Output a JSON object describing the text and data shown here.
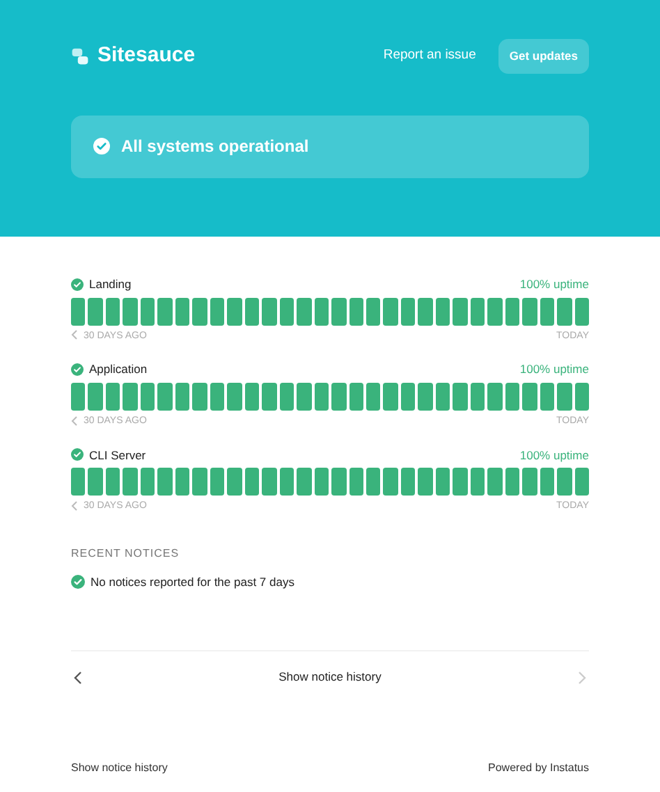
{
  "header": {
    "brand": "Sitesauce",
    "report_link": "Report an issue",
    "updates_button": "Get updates",
    "status": "All systems operational"
  },
  "services": [
    {
      "name": "Landing",
      "uptime": "100% uptime",
      "days": [
        {
          "color": "#3ab37c"
        },
        {
          "color": "#3ab37c"
        },
        {
          "color": "#3ab37c"
        },
        {
          "color": "#3ab37c"
        },
        {
          "color": "#3ab37c"
        },
        {
          "color": "#3ab37c"
        },
        {
          "color": "#3ab37c"
        },
        {
          "color": "#3ab37c"
        },
        {
          "color": "#3ab37c"
        },
        {
          "color": "#3ab37c"
        },
        {
          "color": "#3ab37c"
        },
        {
          "color": "#3ab37c"
        },
        {
          "color": "#3ab37c"
        },
        {
          "color": "#3ab37c"
        },
        {
          "color": "#3ab37c"
        },
        {
          "color": "#3ab37c"
        },
        {
          "color": "#3ab37c"
        },
        {
          "color": "#3ab37c"
        },
        {
          "color": "#3ab37c"
        },
        {
          "color": "#3ab37c"
        },
        {
          "color": "#3ab37c"
        },
        {
          "color": "#3ab37c"
        },
        {
          "color": "#3ab37c"
        },
        {
          "color": "#3ab37c"
        },
        {
          "color": "#3ab37c"
        },
        {
          "color": "#3ab37c"
        },
        {
          "color": "#3ab37c"
        },
        {
          "color": "#3ab37c"
        },
        {
          "color": "#3ab37c"
        },
        {
          "color": "#3ab37c"
        }
      ],
      "start_label": "30 DAYS AGO",
      "end_label": "TODAY"
    },
    {
      "name": "Application",
      "uptime": "100% uptime",
      "days": [
        {
          "color": "#3ab37c"
        },
        {
          "color": "#3ab37c"
        },
        {
          "color": "#3ab37c"
        },
        {
          "color": "#3ab37c"
        },
        {
          "color": "#3ab37c"
        },
        {
          "color": "#3ab37c"
        },
        {
          "color": "#3ab37c"
        },
        {
          "color": "#3ab37c"
        },
        {
          "color": "#3ab37c"
        },
        {
          "color": "#3ab37c"
        },
        {
          "color": "#3ab37c"
        },
        {
          "color": "#3ab37c"
        },
        {
          "color": "#3ab37c"
        },
        {
          "color": "#3ab37c"
        },
        {
          "color": "#3ab37c"
        },
        {
          "color": "#3ab37c"
        },
        {
          "color": "#3ab37c"
        },
        {
          "color": "#3ab37c"
        },
        {
          "color": "#3ab37c"
        },
        {
          "color": "#3ab37c"
        },
        {
          "color": "#3ab37c"
        },
        {
          "color": "#3ab37c"
        },
        {
          "color": "#3ab37c"
        },
        {
          "color": "#3ab37c"
        },
        {
          "color": "#3ab37c"
        },
        {
          "color": "#3ab37c"
        },
        {
          "color": "#3ab37c"
        },
        {
          "color": "#3ab37c"
        },
        {
          "color": "#3ab37c"
        },
        {
          "color": "#3ab37c"
        }
      ],
      "start_label": "30 DAYS AGO",
      "end_label": "TODAY"
    },
    {
      "name": "CLI Server",
      "uptime": "100% uptime",
      "days": [
        {
          "color": "#3ab37c"
        },
        {
          "color": "#3ab37c"
        },
        {
          "color": "#3ab37c"
        },
        {
          "color": "#3ab37c"
        },
        {
          "color": "#3ab37c"
        },
        {
          "color": "#3ab37c"
        },
        {
          "color": "#3ab37c"
        },
        {
          "color": "#3ab37c"
        },
        {
          "color": "#3ab37c"
        },
        {
          "color": "#3ab37c"
        },
        {
          "color": "#3ab37c"
        },
        {
          "color": "#3ab37c"
        },
        {
          "color": "#3ab37c"
        },
        {
          "color": "#3ab37c"
        },
        {
          "color": "#3ab37c"
        },
        {
          "color": "#3ab37c"
        },
        {
          "color": "#3ab37c"
        },
        {
          "color": "#3ab37c"
        },
        {
          "color": "#3ab37c"
        },
        {
          "color": "#3ab37c"
        },
        {
          "color": "#3ab37c"
        },
        {
          "color": "#3ab37c"
        },
        {
          "color": "#3ab37c"
        },
        {
          "color": "#3ab37c"
        },
        {
          "color": "#3ab37c"
        },
        {
          "color": "#3ab37c"
        },
        {
          "color": "#3ab37c"
        },
        {
          "color": "#3ab37c"
        },
        {
          "color": "#3ab37c"
        },
        {
          "color": "#3ab37c"
        }
      ],
      "start_label": "30 DAYS AGO",
      "end_label": "TODAY"
    }
  ],
  "notices": {
    "heading": "RECENT NOTICES",
    "message": "No notices reported for the past 7 days"
  },
  "pager": {
    "label": "Show notice history",
    "prev_disabled": false,
    "next_disabled": true
  },
  "footer": {
    "left": "Show notice history",
    "right": "Powered by Instatus"
  }
}
